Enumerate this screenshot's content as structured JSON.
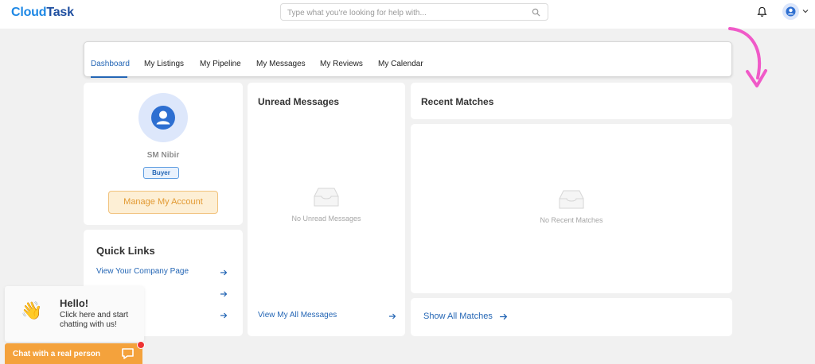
{
  "header": {
    "logo_cloud": "Cloud",
    "logo_task": "Task",
    "search_placeholder": "Type what you're looking for help with..."
  },
  "tabs": [
    {
      "label": "Dashboard",
      "active": true
    },
    {
      "label": "My Listings"
    },
    {
      "label": "My Pipeline"
    },
    {
      "label": "My Messages"
    },
    {
      "label": "My Reviews"
    },
    {
      "label": "My Calendar"
    }
  ],
  "profile": {
    "name": "SM Nibir",
    "role": "Buyer",
    "manage_label": "Manage My Account"
  },
  "quick_links": {
    "title": "Quick Links",
    "items": [
      {
        "label": "View Your Company Page"
      },
      {
        "label": ""
      },
      {
        "label": ""
      }
    ]
  },
  "unread": {
    "title": "Unread Messages",
    "empty_text": "No Unread Messages",
    "view_all_label": "View My All Messages"
  },
  "recent": {
    "title": "Recent Matches",
    "empty_text": "No Recent Matches",
    "show_all_label": "Show All Matches"
  },
  "chat": {
    "greeting": "Hello!",
    "subtitle": "Click here and start chatting with us!",
    "bar_label": "Chat with a real person"
  },
  "colors": {
    "accent": "#2466b5",
    "orange": "#f4a23c",
    "pink_arrow": "#f05ac8"
  }
}
